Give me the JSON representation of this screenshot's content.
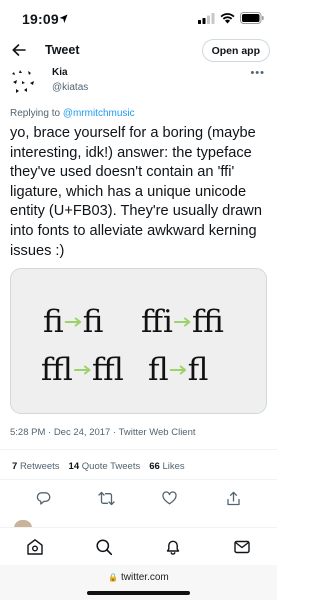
{
  "status_bar": {
    "time": "19:09"
  },
  "header": {
    "title": "Tweet",
    "open_app": "Open app"
  },
  "author": {
    "name": "Kia",
    "handle": "@kiatas"
  },
  "reply": {
    "prefix": "Replying to ",
    "mention": "@mrmitchmusic"
  },
  "tweet": {
    "text": "yo, brace yourself for a boring (maybe interesting, idk!) answer: the typeface they've used doesn't contain an 'ffi' ligature, which has a unique unicode entity (U+FB03). They're usually drawn into fonts to alleviate awkward kerning issues :)"
  },
  "media": {
    "arrow_color": "#9bd36a",
    "ligature_pairs": [
      {
        "left": "fi",
        "right": "ﬁ"
      },
      {
        "left": "ffi",
        "right": "ﬃ"
      },
      {
        "left": "ffl",
        "right": "ﬄ"
      },
      {
        "left": "fl",
        "right": "ﬂ"
      }
    ]
  },
  "meta": {
    "text": "5:28 PM · Dec 24, 2017 · Twitter Web Client"
  },
  "stats": {
    "retweets_count": "7",
    "retweets_label": "Retweets",
    "quotes_count": "14",
    "quotes_label": "Quote Tweets",
    "likes_count": "66",
    "likes_label": "Likes"
  },
  "actions": [
    "reply-icon",
    "retweet-icon",
    "like-icon",
    "share-icon"
  ],
  "bottom_nav": [
    "home-icon",
    "search-icon",
    "notifications-icon",
    "messages-icon"
  ],
  "url_bar": {
    "url": "twitter.com"
  },
  "colors": {
    "accent": "#1d9bf0",
    "secondary_text": "#536471",
    "primary_text": "#0f1419"
  }
}
